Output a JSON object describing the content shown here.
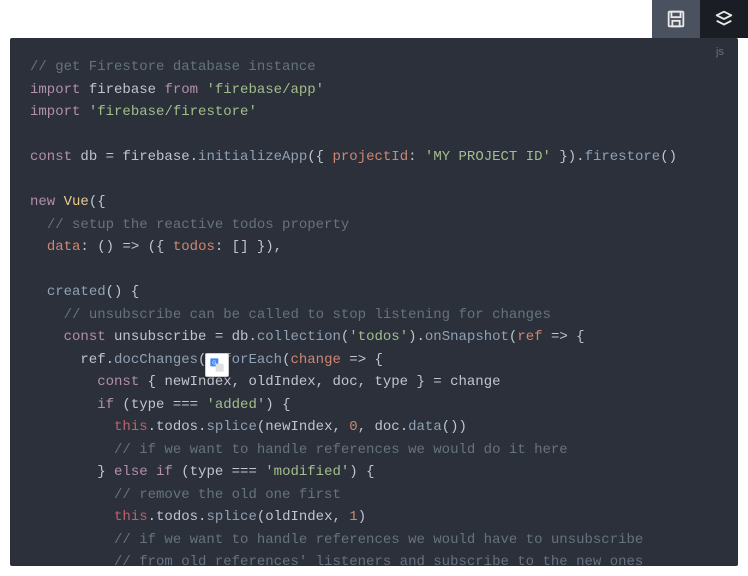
{
  "lang_badge": "js",
  "lines": [
    [
      [
        "c-comment",
        "// get Firestore database instance"
      ]
    ],
    [
      [
        "c-keyword",
        "import"
      ],
      [
        "c-default",
        " firebase "
      ],
      [
        "c-keyword",
        "from"
      ],
      [
        "c-default",
        " "
      ],
      [
        "c-string",
        "'firebase/app'"
      ]
    ],
    [
      [
        "c-keyword",
        "import"
      ],
      [
        "c-default",
        " "
      ],
      [
        "c-string",
        "'firebase/firestore'"
      ]
    ],
    [
      [
        "c-default",
        ""
      ]
    ],
    [
      [
        "c-keyword",
        "const"
      ],
      [
        "c-default",
        " db = firebase."
      ],
      [
        "c-func",
        "initializeApp"
      ],
      [
        "c-default",
        "({ "
      ],
      [
        "c-attr",
        "projectId"
      ],
      [
        "c-default",
        ": "
      ],
      [
        "c-string",
        "'MY PROJECT ID'"
      ],
      [
        "c-default",
        " })."
      ],
      [
        "c-func",
        "firestore"
      ],
      [
        "c-default",
        "()"
      ]
    ],
    [
      [
        "c-default",
        ""
      ]
    ],
    [
      [
        "c-keyword",
        "new"
      ],
      [
        "c-default",
        " "
      ],
      [
        "c-name",
        "Vue"
      ],
      [
        "c-default",
        "({"
      ]
    ],
    [
      [
        "c-default",
        "  "
      ],
      [
        "c-comment",
        "// setup the reactive todos property"
      ]
    ],
    [
      [
        "c-default",
        "  "
      ],
      [
        "c-attr",
        "data"
      ],
      [
        "c-default",
        ": "
      ],
      [
        "c-punct",
        "()"
      ],
      [
        "c-default",
        " => ({ "
      ],
      [
        "c-attr",
        "todos"
      ],
      [
        "c-default",
        ": [] }),"
      ]
    ],
    [
      [
        "c-default",
        ""
      ]
    ],
    [
      [
        "c-default",
        "  "
      ],
      [
        "c-func",
        "created"
      ],
      [
        "c-default",
        "() {"
      ]
    ],
    [
      [
        "c-default",
        "    "
      ],
      [
        "c-comment",
        "// unsubscribe can be called to stop listening for changes"
      ]
    ],
    [
      [
        "c-default",
        "    "
      ],
      [
        "c-keyword",
        "const"
      ],
      [
        "c-default",
        " unsubscribe = db."
      ],
      [
        "c-func",
        "collection"
      ],
      [
        "c-default",
        "("
      ],
      [
        "c-string",
        "'todos'"
      ],
      [
        "c-default",
        ")."
      ],
      [
        "c-func",
        "onSnapshot"
      ],
      [
        "c-default",
        "("
      ],
      [
        "c-attr",
        "ref"
      ],
      [
        "c-default",
        " => {"
      ]
    ],
    [
      [
        "c-default",
        "      ref."
      ],
      [
        "c-func",
        "docChanges"
      ],
      [
        "c-default",
        "()."
      ],
      [
        "c-func",
        "forEach"
      ],
      [
        "c-default",
        "("
      ],
      [
        "c-attr",
        "change"
      ],
      [
        "c-default",
        " => {"
      ]
    ],
    [
      [
        "c-default",
        "        "
      ],
      [
        "c-keyword",
        "const"
      ],
      [
        "c-default",
        " { newIndex, oldIndex, doc, type } = change"
      ]
    ],
    [
      [
        "c-default",
        "        "
      ],
      [
        "c-keyword",
        "if"
      ],
      [
        "c-default",
        " (type === "
      ],
      [
        "c-string",
        "'added'"
      ],
      [
        "c-default",
        ") {"
      ]
    ],
    [
      [
        "c-default",
        "          "
      ],
      [
        "c-this",
        "this"
      ],
      [
        "c-default",
        ".todos."
      ],
      [
        "c-func",
        "splice"
      ],
      [
        "c-default",
        "(newIndex, "
      ],
      [
        "c-num",
        "0"
      ],
      [
        "c-default",
        ", doc."
      ],
      [
        "c-func",
        "data"
      ],
      [
        "c-default",
        "())"
      ]
    ],
    [
      [
        "c-default",
        "          "
      ],
      [
        "c-comment",
        "// if we want to handle references we would do it here"
      ]
    ],
    [
      [
        "c-default",
        "        } "
      ],
      [
        "c-keyword",
        "else"
      ],
      [
        "c-default",
        " "
      ],
      [
        "c-keyword",
        "if"
      ],
      [
        "c-default",
        " (type === "
      ],
      [
        "c-string",
        "'modified'"
      ],
      [
        "c-default",
        ") {"
      ]
    ],
    [
      [
        "c-default",
        "          "
      ],
      [
        "c-comment",
        "// remove the old one first"
      ]
    ],
    [
      [
        "c-default",
        "          "
      ],
      [
        "c-this",
        "this"
      ],
      [
        "c-default",
        ".todos."
      ],
      [
        "c-func",
        "splice"
      ],
      [
        "c-default",
        "(oldIndex, "
      ],
      [
        "c-num",
        "1"
      ],
      [
        "c-default",
        ")"
      ]
    ],
    [
      [
        "c-default",
        "          "
      ],
      [
        "c-comment",
        "// if we want to handle references we would have to unsubscribe"
      ]
    ],
    [
      [
        "c-default",
        "          "
      ],
      [
        "c-comment",
        "// from old references' listeners and subscribe to the new ones"
      ]
    ]
  ]
}
